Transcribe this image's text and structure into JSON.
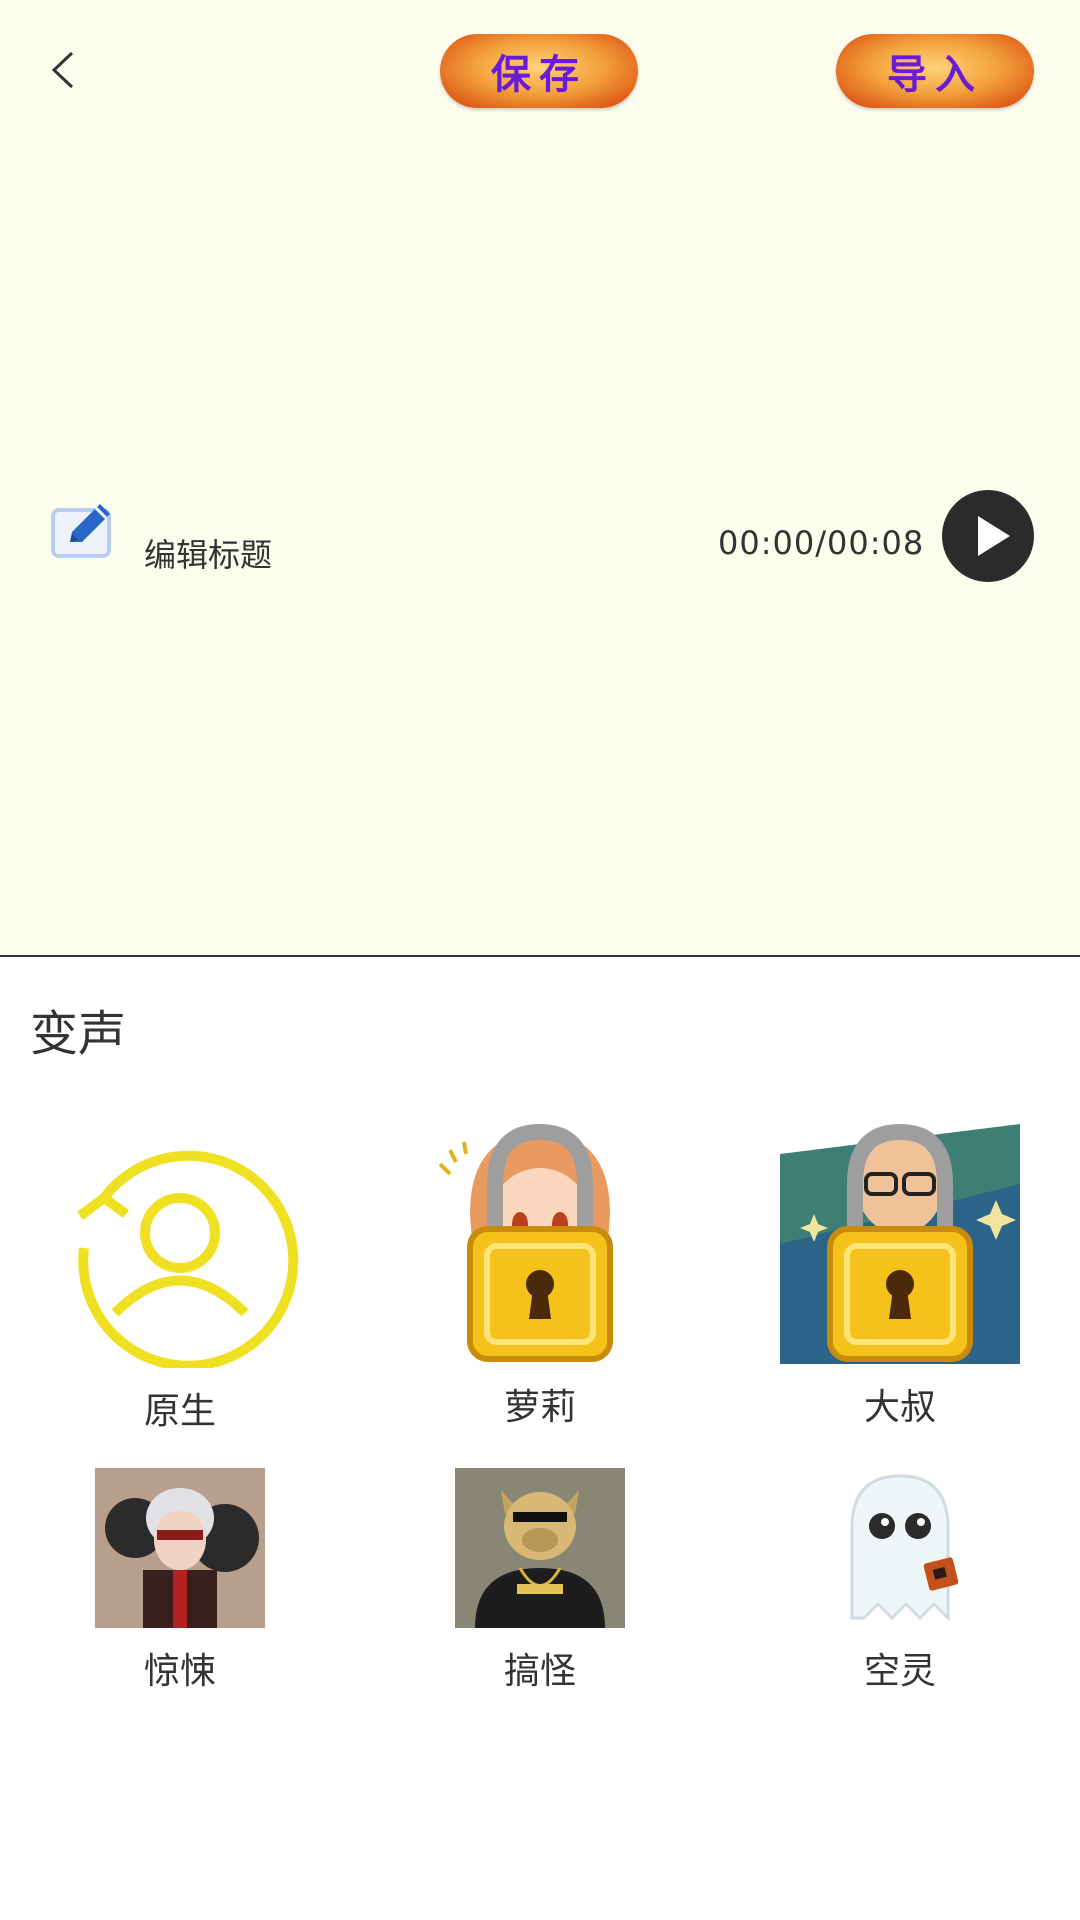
{
  "header": {
    "save_label": "保存",
    "import_label": "导入"
  },
  "editor": {
    "edit_title_label": "编辑标题",
    "time_display": "00:00/00:08"
  },
  "voice_change": {
    "section_title": "变声",
    "options": [
      {
        "label": "原生",
        "locked": false,
        "icon": "reset-user-icon"
      },
      {
        "label": "萝莉",
        "locked": true,
        "icon": "girl-avatar"
      },
      {
        "label": "大叔",
        "locked": true,
        "icon": "man-avatar"
      },
      {
        "label": "惊悚",
        "locked": false,
        "icon": "horror-avatar"
      },
      {
        "label": "搞怪",
        "locked": false,
        "icon": "funny-pig-avatar"
      },
      {
        "label": "空灵",
        "locked": false,
        "icon": "ghost-avatar"
      }
    ]
  },
  "colors": {
    "top_background": "#fdfdee",
    "pill_text": "#6a1bd6",
    "accent_yellow": "#f0e022",
    "edit_icon_blue": "#2a67c9"
  }
}
